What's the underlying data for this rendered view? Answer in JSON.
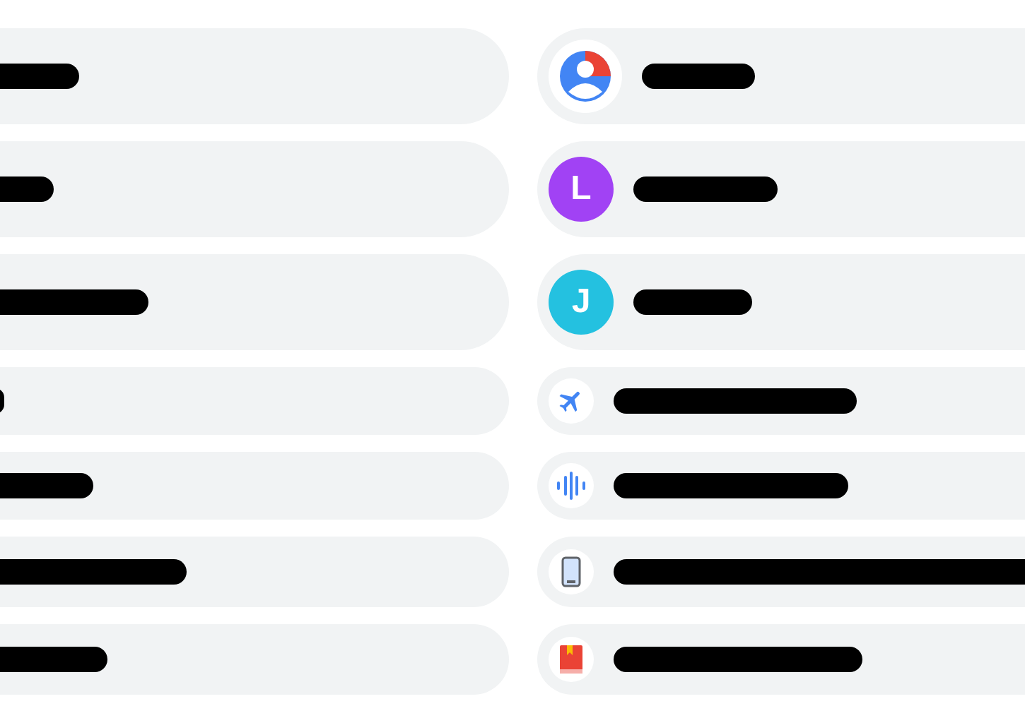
{
  "left_list": [
    {
      "redacted": true
    },
    {
      "redacted": true
    },
    {
      "redacted": true
    },
    {
      "redacted": true
    },
    {
      "redacted": true
    },
    {
      "redacted": true
    },
    {
      "redacted": true
    }
  ],
  "right_list": [
    {
      "kind": "account",
      "redacted": true
    },
    {
      "kind": "letter",
      "letter": "L",
      "color": "#a142f4",
      "redacted": true
    },
    {
      "kind": "letter",
      "letter": "J",
      "color": "#24c1e0",
      "redacted": true
    },
    {
      "kind": "plane",
      "redacted": true
    },
    {
      "kind": "voice",
      "redacted": true
    },
    {
      "kind": "phone",
      "redacted": true
    },
    {
      "kind": "book",
      "redacted": true
    }
  ]
}
